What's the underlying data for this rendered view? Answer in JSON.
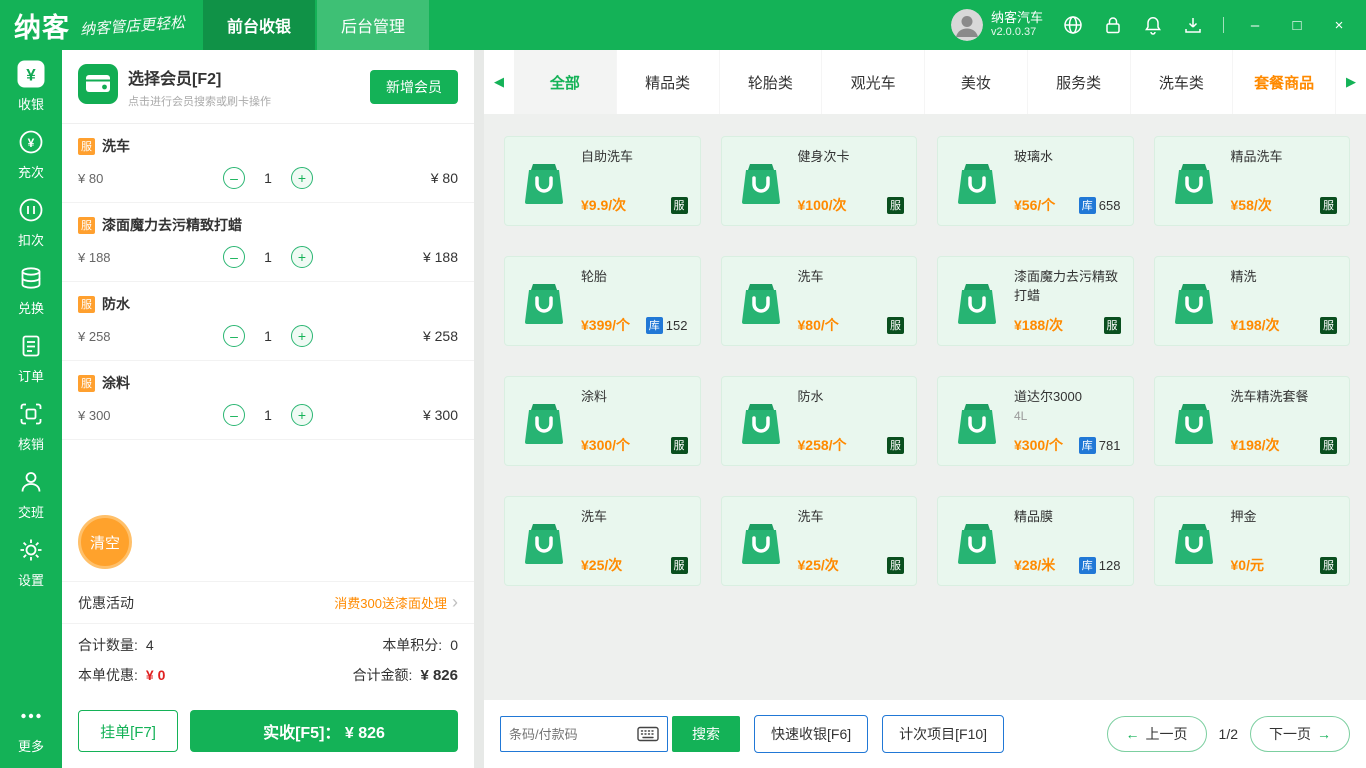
{
  "colors": {
    "brand_green": "#14b257",
    "service_badge_green": "#0a4f1f",
    "stock_badge_blue": "#2178d6",
    "price_orange": "#ff8a00",
    "discount_red": "#e02020"
  },
  "topbar": {
    "logo": "纳客",
    "slogan": "纳客管店更轻松",
    "tabs": [
      {
        "label": "前台收银",
        "state": "active"
      },
      {
        "label": "后台管理"
      }
    ],
    "store_name": "纳客汽车",
    "version": "v2.0.0.37",
    "window": {
      "minimize": "–",
      "maximize": "□",
      "close": "×"
    }
  },
  "sidebar": {
    "items": [
      {
        "label": "收银",
        "icon": "cashier-icon",
        "state": "active"
      },
      {
        "label": "充次",
        "icon": "recharge-icon"
      },
      {
        "label": "扣次",
        "icon": "deduct-icon"
      },
      {
        "label": "兑换",
        "icon": "exchange-icon"
      },
      {
        "label": "订单",
        "icon": "order-icon"
      },
      {
        "label": "核销",
        "icon": "verify-icon"
      },
      {
        "label": "交班",
        "icon": "shift-icon"
      },
      {
        "label": "设置",
        "icon": "settings-icon"
      },
      {
        "label": "更多",
        "icon": "more-icon",
        "state": "more"
      }
    ]
  },
  "cart": {
    "member_title": "选择会员[F2]",
    "member_subtitle": "点击进行会员搜索或刷卡操作",
    "add_member_label": "新增会员",
    "items": [
      {
        "badge": "服",
        "name": "洗车",
        "price": "¥ 80",
        "qty": "1",
        "total": "¥ 80"
      },
      {
        "badge": "服",
        "name": "漆面魔力去污精致打蜡",
        "price": "¥ 188",
        "qty": "1",
        "total": "¥ 188"
      },
      {
        "badge": "服",
        "name": "防水",
        "price": "¥ 258",
        "qty": "1",
        "total": "¥ 258"
      },
      {
        "badge": "服",
        "name": "涂料",
        "price": "¥ 300",
        "qty": "1",
        "total": "¥ 300"
      }
    ],
    "clear_label": "清空",
    "promo_label": "优惠活动",
    "promo_value": "消费300送漆面处理",
    "summary": {
      "qty_label": "合计数量:",
      "qty_value": "4",
      "points_label": "本单积分:",
      "points_value": "0",
      "discount_label": "本单优惠:",
      "discount_value": "¥ 0",
      "amount_label": "合计金额:",
      "amount_value": "¥ 826"
    },
    "hold_label": "挂单[F7]",
    "pay_label": "实收[F5]：  ¥ 826"
  },
  "categories": {
    "tabs": [
      {
        "label": "全部",
        "state": "active"
      },
      {
        "label": "精品类"
      },
      {
        "label": "轮胎类"
      },
      {
        "label": "观光车"
      },
      {
        "label": "美妆"
      },
      {
        "label": "服务类"
      },
      {
        "label": "洗车类"
      },
      {
        "label": "套餐商品",
        "state": "highlight"
      }
    ]
  },
  "products": [
    {
      "name": "自助洗车",
      "price": "¥9.9/次",
      "badge": "服",
      "badge_type": "srv"
    },
    {
      "name": "健身次卡",
      "price": "¥100/次",
      "badge": "服",
      "badge_type": "srv"
    },
    {
      "name": "玻璃水",
      "price": "¥56/个",
      "badge": "库",
      "badge_type": "stock",
      "stock": "658"
    },
    {
      "name": "精品洗车",
      "price": "¥58/次",
      "badge": "服",
      "badge_type": "srv"
    },
    {
      "name": "轮胎",
      "price": "¥399/个",
      "badge": "库",
      "badge_type": "stock",
      "stock": "152"
    },
    {
      "name": "洗车",
      "price": "¥80/个",
      "badge": "服",
      "badge_type": "srv"
    },
    {
      "name": "漆面魔力去污精致打蜡",
      "price": "¥188/次",
      "badge": "服",
      "badge_type": "srv"
    },
    {
      "name": "精洗",
      "price": "¥198/次",
      "badge": "服",
      "badge_type": "srv"
    },
    {
      "name": "涂料",
      "price": "¥300/个",
      "badge": "服",
      "badge_type": "srv"
    },
    {
      "name": "防水",
      "price": "¥258/个",
      "badge": "服",
      "badge_type": "srv"
    },
    {
      "name": "道达尔3000",
      "subtitle": "4L",
      "price": "¥300/个",
      "badge": "库",
      "badge_type": "stock",
      "stock": "781"
    },
    {
      "name": "洗车精洗套餐",
      "price": "¥198/次",
      "badge": "服",
      "badge_type": "srv"
    },
    {
      "name": "洗车",
      "price": "¥25/次",
      "badge": "服",
      "badge_type": "srv"
    },
    {
      "name": "洗车",
      "price": "¥25/次",
      "badge": "服",
      "badge_type": "srv"
    },
    {
      "name": "精品膜",
      "price": "¥28/米",
      "badge": "库",
      "badge_type": "stock",
      "stock": "128"
    },
    {
      "name": "押金",
      "price": "¥0/元",
      "badge": "服",
      "badge_type": "srv"
    }
  ],
  "bottombar": {
    "input_placeholder": "条码/付款码",
    "search_label": "搜索",
    "quick_label": "快速收银[F6]",
    "count_label": "计次项目[F10]",
    "prev_label": "上一页",
    "page_info": "1/2",
    "next_label": "下一页"
  }
}
